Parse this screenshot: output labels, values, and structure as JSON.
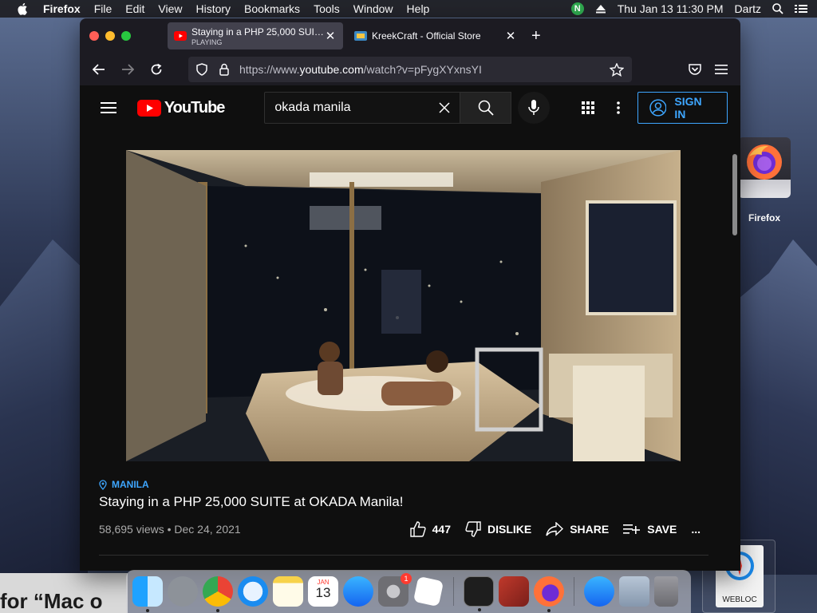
{
  "menubar": {
    "app_name": "Firefox",
    "menus": [
      "File",
      "Edit",
      "View",
      "History",
      "Bookmarks",
      "Tools",
      "Window",
      "Help"
    ],
    "clock": "Thu Jan 13  11:30 PM",
    "user": "Dartz",
    "status_icon_letter": "N"
  },
  "desktop": {
    "firefox_icon_label": "Firefox",
    "webloc_label": "WEBLOC",
    "bottom_text": "for “Mac o"
  },
  "browser": {
    "tabs": [
      {
        "title": "Staying in a PHP 25,000 SUITE at OKADA Manila!",
        "subtitle": "PLAYING",
        "active": true
      },
      {
        "title": "KreekCraft - Official Store",
        "subtitle": "",
        "active": false
      }
    ],
    "url_prefix": "https://www.",
    "url_domain": "youtube.com",
    "url_path": "/watch?v=pFygXYxnsYI"
  },
  "youtube": {
    "logo_text": "YouTube",
    "search_value": "okada manila",
    "sign_in_label": "SIGN IN",
    "location_tag": "MANILA",
    "video_title": "Staying in a PHP 25,000 SUITE at OKADA Manila!",
    "views_date": "58,695 views • Dec 24, 2021",
    "like_count": "447",
    "dislike_label": "DISLIKE",
    "share_label": "SHARE",
    "save_label": "SAVE",
    "more_label": "..."
  },
  "dock": {
    "apps": [
      "finder-icon",
      "launchpad-icon",
      "chrome-icon",
      "safari-icon",
      "notes-icon",
      "calendar-icon",
      "app-store-icon",
      "system-preferences-icon",
      "roblox-icon",
      "terminal-icon",
      "photo-booth-icon",
      "firefox-icon",
      "app-store-downloads-icon",
      "documents-icon",
      "trash-icon"
    ],
    "calendar_month": "JAN",
    "calendar_day": "13",
    "system_prefs_badge": "1"
  },
  "colors": {
    "yt_red": "#ff0000",
    "yt_blue": "#3ea6ff",
    "firefox_tab_active": "#42414d",
    "youtube_bg": "#0f0f0f"
  }
}
